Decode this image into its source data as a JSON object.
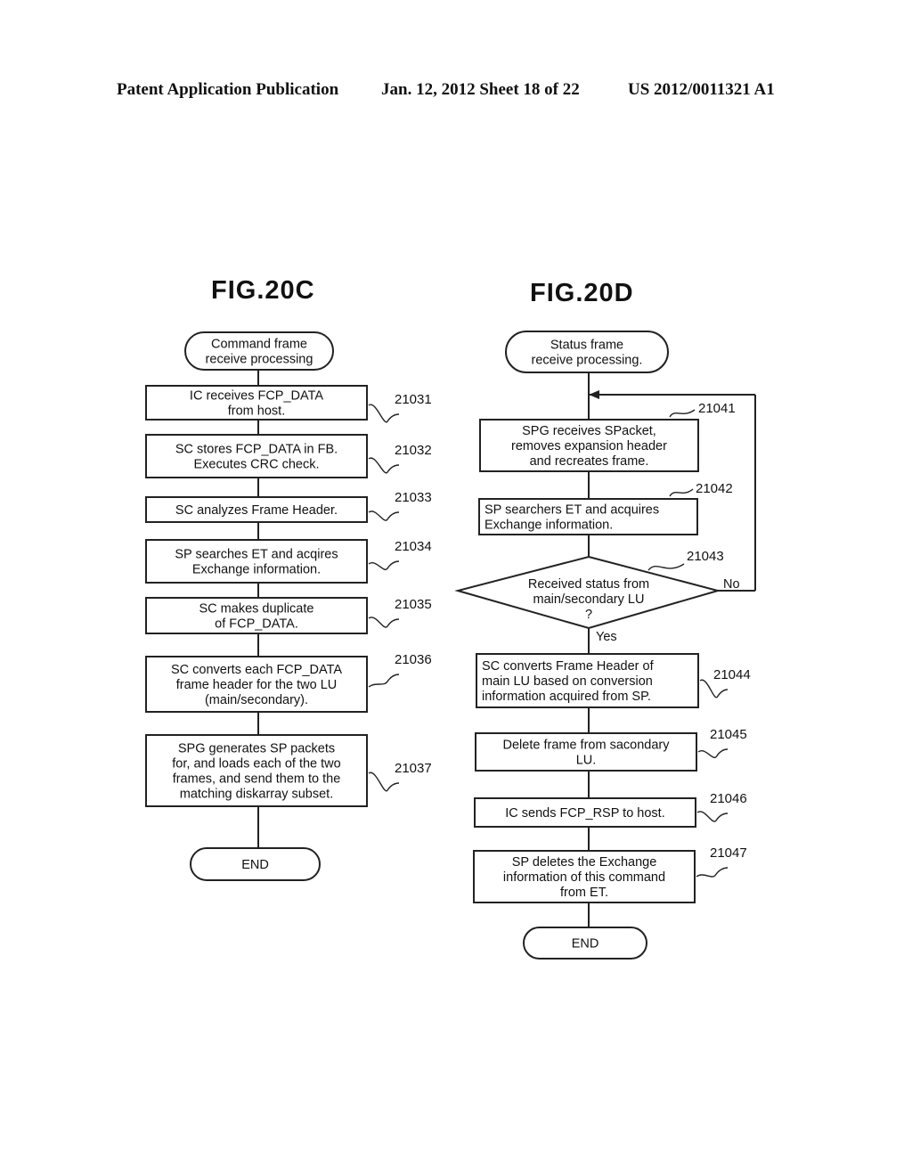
{
  "header": {
    "left": "Patent Application Publication",
    "middle": "Jan. 12, 2012  Sheet 18 of 22",
    "right": "US 2012/0011321 A1"
  },
  "fig_c": {
    "title": "FIG.20C",
    "start": [
      "Command frame",
      "receive processing"
    ],
    "steps": [
      {
        "ref": "21031",
        "lines": [
          "IC receives FCP_DATA",
          "from host."
        ]
      },
      {
        "ref": "21032",
        "lines": [
          "SC stores FCP_DATA in FB.",
          "Executes CRC check."
        ]
      },
      {
        "ref": "21033",
        "lines": [
          "SC analyzes Frame Header."
        ]
      },
      {
        "ref": "21034",
        "lines": [
          "SP searches ET and acqires",
          "Exchange information."
        ]
      },
      {
        "ref": "21035",
        "lines": [
          "SC makes duplicate",
          "of FCP_DATA."
        ]
      },
      {
        "ref": "21036",
        "lines": [
          "SC converts each FCP_DATA",
          "frame header for the two LU",
          "(main/secondary)."
        ]
      },
      {
        "ref": "21037",
        "lines": [
          "SPG generates SP packets",
          "for, and loads each of the two",
          "frames,  and send them to the",
          "matching diskarray subset."
        ]
      }
    ],
    "end": "END"
  },
  "fig_d": {
    "title": "FIG.20D",
    "start": [
      "Status frame",
      "receive processing."
    ],
    "steps": [
      {
        "ref": "21041",
        "lines": [
          "SPG receives SPacket,",
          "removes expansion header",
          "and recreates frame."
        ]
      },
      {
        "ref": "21042",
        "lines": [
          "SP searchers ET and acquires",
          "Exchange information."
        ]
      }
    ],
    "decision": {
      "ref": "21043",
      "lines": [
        "Received status from",
        "main/secondary LU",
        "?"
      ],
      "yes": "Yes",
      "no": "No"
    },
    "steps_after": [
      {
        "ref": "21044",
        "lines": [
          "SC converts Frame Header of",
          "main LU based on conversion",
          "information acquired from SP."
        ]
      },
      {
        "ref": "21045",
        "lines": [
          "Delete frame from sacondary",
          "LU."
        ]
      },
      {
        "ref": "21046",
        "lines": [
          "IC sends FCP_RSP to host."
        ]
      },
      {
        "ref": "21047",
        "lines": [
          "SP deletes the Exchange",
          "information of this command",
          "from ET."
        ]
      }
    ],
    "end": "END"
  }
}
